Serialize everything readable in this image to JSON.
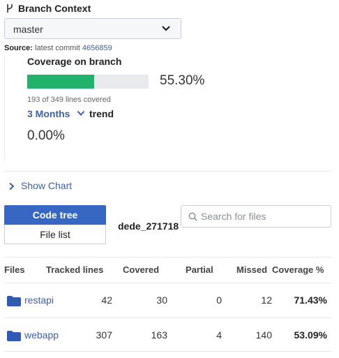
{
  "branch_context": {
    "title": "Branch Context",
    "selected_branch": "master"
  },
  "source": {
    "label": "Source:",
    "text": "latest commit",
    "commit": "4656859"
  },
  "coverage": {
    "title": "Coverage on branch",
    "percent_text": "55.30%",
    "fill_fraction": 0.553,
    "lines_text": "193 of 349 lines covered",
    "bar_color": "#21b26b"
  },
  "trend": {
    "range": "3 Months",
    "label": "trend",
    "value": "0.00%"
  },
  "show_chart": "Show Chart",
  "view_toggle": {
    "code_tree": "Code tree",
    "file_list": "File list"
  },
  "path_label": "dede_271718",
  "search": {
    "placeholder": "Search for files",
    "value": ""
  },
  "table": {
    "headers": {
      "files": "Files",
      "tracked": "Tracked lines",
      "covered": "Covered",
      "partial": "Partial",
      "missed": "Missed",
      "coverage": "Coverage %"
    },
    "rows": [
      {
        "name": "restapi",
        "tracked": "42",
        "covered": "30",
        "partial": "0",
        "missed": "12",
        "coverage": "71.43%"
      },
      {
        "name": "webapp",
        "tracked": "307",
        "covered": "163",
        "partial": "4",
        "missed": "140",
        "coverage": "53.09%"
      }
    ]
  },
  "colors": {
    "accent": "#3668c3",
    "link": "#3d5fa8",
    "folder": "#2f5bb4"
  },
  "icons": {
    "branch": "git-branch-icon",
    "dropdown": "chevron-down-icon",
    "show_chart": "chevron-right-icon",
    "search": "search-icon",
    "folder": "folder-icon"
  }
}
